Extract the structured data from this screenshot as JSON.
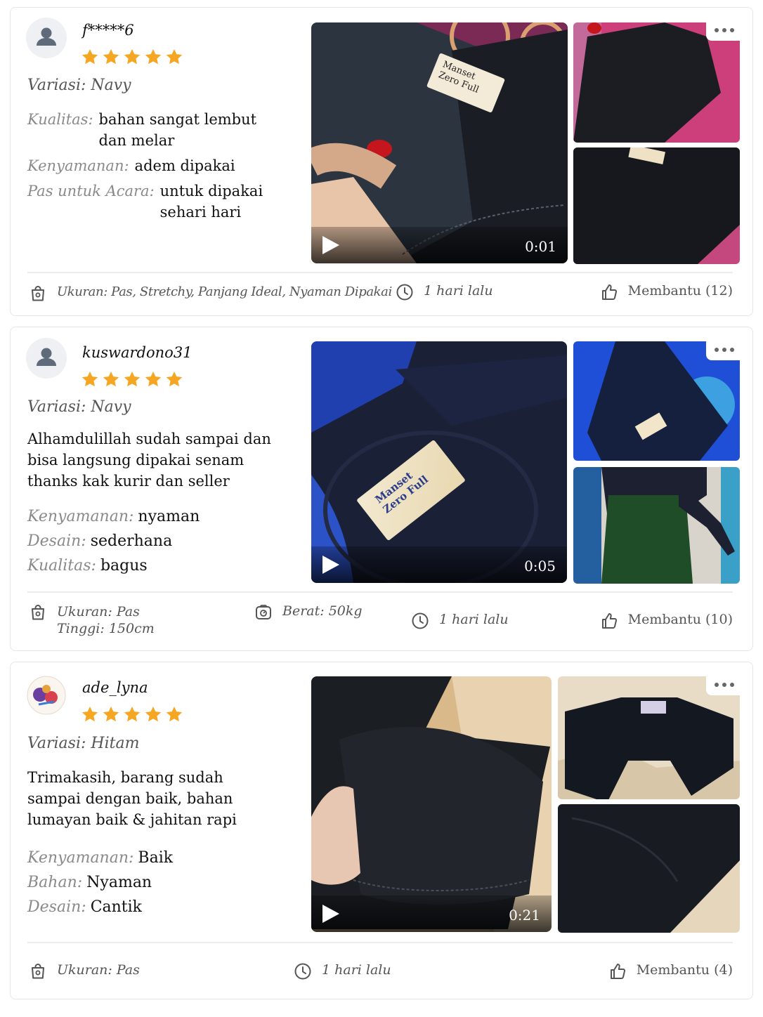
{
  "reviews": [
    {
      "username": "f*****6",
      "rating": 5,
      "variation": "Variasi: Navy",
      "attributes": [
        {
          "label": "Kualitas:",
          "value": "bahan sangat lembut dan melar"
        },
        {
          "label": "Kenyamanan:",
          "value": "adem dipakai"
        },
        {
          "label": "Pas untuk Acara:",
          "value": "untuk dipakai sehari hari"
        }
      ],
      "video_duration": "0:01",
      "footer": {
        "size": "Ukuran: Pas, Stretchy, Panjang Ideal, Nyaman Dipakai",
        "time": "1 hari lalu",
        "helpful": "Membantu (12)"
      }
    },
    {
      "username": "kuswardono31",
      "rating": 5,
      "variation": "Variasi: Navy",
      "text": "Alhamdulillah sudah sampai dan bisa langsung dipakai senam thanks kak kurir dan seller",
      "attributes": [
        {
          "label": "Kenyamanan:",
          "value": "nyaman"
        },
        {
          "label": "Desain:",
          "value": "sederhana"
        },
        {
          "label": "Kualitas:",
          "value": "bagus"
        }
      ],
      "video_duration": "0:05",
      "footer": {
        "size": "Ukuran: Pas",
        "height": "Tinggi: 150cm",
        "weight": "Berat: 50kg",
        "time": "1 hari lalu",
        "helpful": "Membantu (10)"
      }
    },
    {
      "username": "ade_lyna",
      "rating": 5,
      "variation": "Variasi: Hitam",
      "text": "Trimakasih, barang sudah sampai dengan baik, bahan lumayan baik & jahitan rapi",
      "attributes": [
        {
          "label": "Kenyamanan:",
          "value": "Baik"
        },
        {
          "label": "Bahan:",
          "value": "Nyaman"
        },
        {
          "label": "Desain:",
          "value": "Cantik"
        }
      ],
      "video_duration": "0:21",
      "footer": {
        "size": "Ukuran: Pas",
        "time": "1 hari lalu",
        "helpful": "Membantu (4)"
      }
    }
  ],
  "product_tag": {
    "line1": "Manset",
    "line2": "Zero Full"
  },
  "colors": {
    "star": "#f5a623",
    "border": "#e6e6e6",
    "label_gray": "#8a8a8a"
  }
}
